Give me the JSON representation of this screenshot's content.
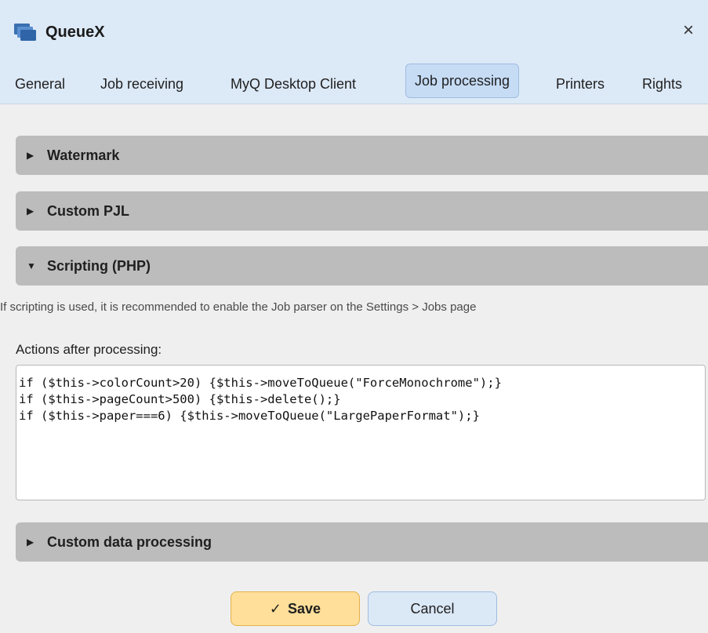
{
  "window": {
    "title": "QueueX",
    "close_glyph": "×",
    "icon": "queue-icon"
  },
  "tabs": [
    {
      "label": "General",
      "active": false
    },
    {
      "label": "Job receiving",
      "active": false
    },
    {
      "label": "MyQ Desktop Client",
      "active": false
    },
    {
      "label": "Job processing",
      "active": true
    },
    {
      "label": "Printers",
      "active": false
    },
    {
      "label": "Rights",
      "active": false
    }
  ],
  "sections": {
    "watermark": {
      "label": "Watermark",
      "arrow": "▶",
      "expanded": false
    },
    "custom_pjl": {
      "label": "Custom PJL",
      "arrow": "▶",
      "expanded": false
    },
    "scripting": {
      "label": "Scripting (PHP)",
      "arrow": "▼",
      "expanded": true
    },
    "custom_data": {
      "label": "Custom data processing",
      "arrow": "▶",
      "expanded": false
    }
  },
  "scripting": {
    "hint": "If scripting is used, it is recommended to enable the Job parser on the Settings > Jobs page",
    "actions_label": "Actions after processing:",
    "code_lines": [
      "if ($this->colorCount>20) {$this->moveToQueue(\"ForceMonochrome\");}",
      "if ($this->pageCount>500) {$this->delete();}",
      "if ($this->paper===6) {$this->moveToQueue(\"LargePaperFormat\");}"
    ]
  },
  "buttons": {
    "save_label": "Save",
    "save_icon": "✓",
    "cancel_label": "Cancel"
  },
  "colors": {
    "title_bar": "#dce9f7",
    "active_tab": "#c6dcf5",
    "section_header": "#bcbcbc",
    "save_button": "#ffdf9a",
    "cancel_button": "#dbe8f6"
  }
}
